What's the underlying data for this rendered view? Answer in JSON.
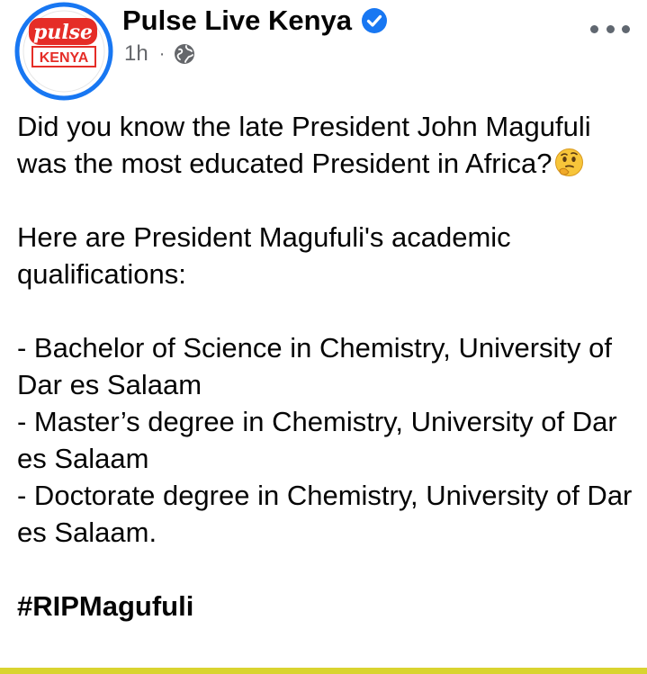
{
  "post": {
    "page_name": "Pulse Live Kenya",
    "avatar_brand_text": "pulse",
    "avatar_region_text": "KENYA",
    "timestamp": "1h",
    "separator": "·",
    "audience_icon": "globe-icon",
    "verified_icon": "verified-badge-icon",
    "menu_icon": "more-options-icon",
    "text_line1": "Did you know the late President John Magufuli was the most educated President in Africa?",
    "intro_line": "Here are President Magufuli's academic qualifications:",
    "qualifications": [
      "- Bachelor of Science in Chemistry, University of Dar es Salaam",
      "- Master’s degree in Chemistry, University of Dar es Salaam",
      "- Doctorate degree in Chemistry, University of Dar es Salaam."
    ],
    "hashtag": "#RIPMagufuli",
    "emoji": "thinking-face-emoji"
  },
  "colors": {
    "brand_red": "#e52d27",
    "avatar_ring": "#1877f2",
    "verified_blue": "#1877f2",
    "meta_gray": "#65676b",
    "bottom_bar": "#d9d430"
  }
}
